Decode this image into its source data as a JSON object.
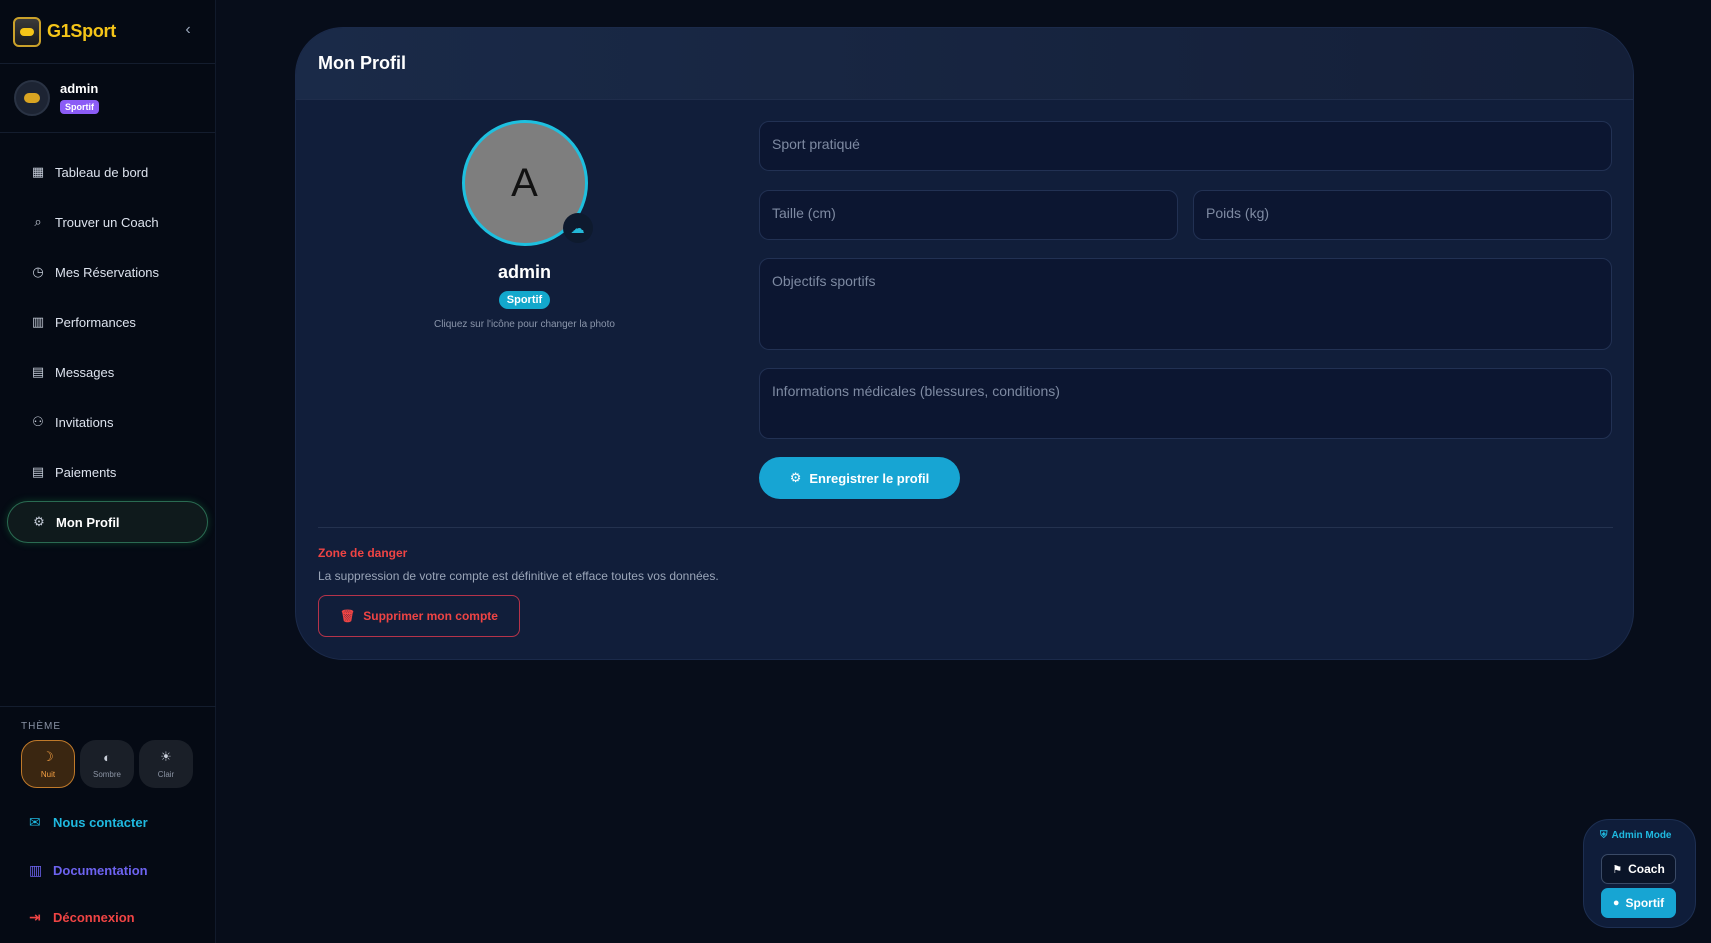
{
  "brand": {
    "name": "G1Sport",
    "logo_icon": "shield-logo-icon"
  },
  "user": {
    "name": "admin",
    "role": "Sportif"
  },
  "nav": [
    {
      "label": "Tableau de bord",
      "icon": "dashboard-icon"
    },
    {
      "label": "Trouver un Coach",
      "icon": "search-icon"
    },
    {
      "label": "Mes Réservations",
      "icon": "clock-icon"
    },
    {
      "label": "Performances",
      "icon": "chart-icon"
    },
    {
      "label": "Messages",
      "icon": "message-icon"
    },
    {
      "label": "Invitations",
      "icon": "person-add-icon"
    },
    {
      "label": "Paiements",
      "icon": "receipt-icon"
    },
    {
      "label": "Mon Profil",
      "icon": "profile-settings-icon",
      "active": true
    }
  ],
  "theme": {
    "title": "THÈME",
    "options": [
      {
        "label": "Nuit",
        "icon": "moon-icon",
        "active": true
      },
      {
        "label": "Sombre",
        "icon": "contrast-icon"
      },
      {
        "label": "Clair",
        "icon": "sun-icon"
      }
    ]
  },
  "footer": {
    "contact": "Nous contacter",
    "docs": "Documentation",
    "logout": "Déconnexion"
  },
  "card": {
    "title": "Mon Profil",
    "avatar_letter": "A",
    "name": "admin",
    "role": "Sportif",
    "hint": "Cliquez sur l'icône pour changer la photo",
    "fields": {
      "sport": "Sport pratiqué",
      "taille": "Taille (cm)",
      "poids": "Poids (kg)",
      "objectifs": "Objectifs sportifs",
      "medical": "Informations médicales (blessures, conditions)"
    },
    "save_label": "Enregistrer le profil",
    "danger": {
      "title": "Zone de danger",
      "text": "La suppression de votre compte est définitive et efface toutes vos données.",
      "button": "Supprimer mon compte"
    }
  },
  "admin_mode": {
    "title": "Admin Mode",
    "coach": "Coach",
    "sportif": "Sportif"
  },
  "colors": {
    "accent": "#17a5d3",
    "danger": "#ef4444",
    "brand": "#f5c518",
    "role_pill": "#8b5cf6"
  }
}
